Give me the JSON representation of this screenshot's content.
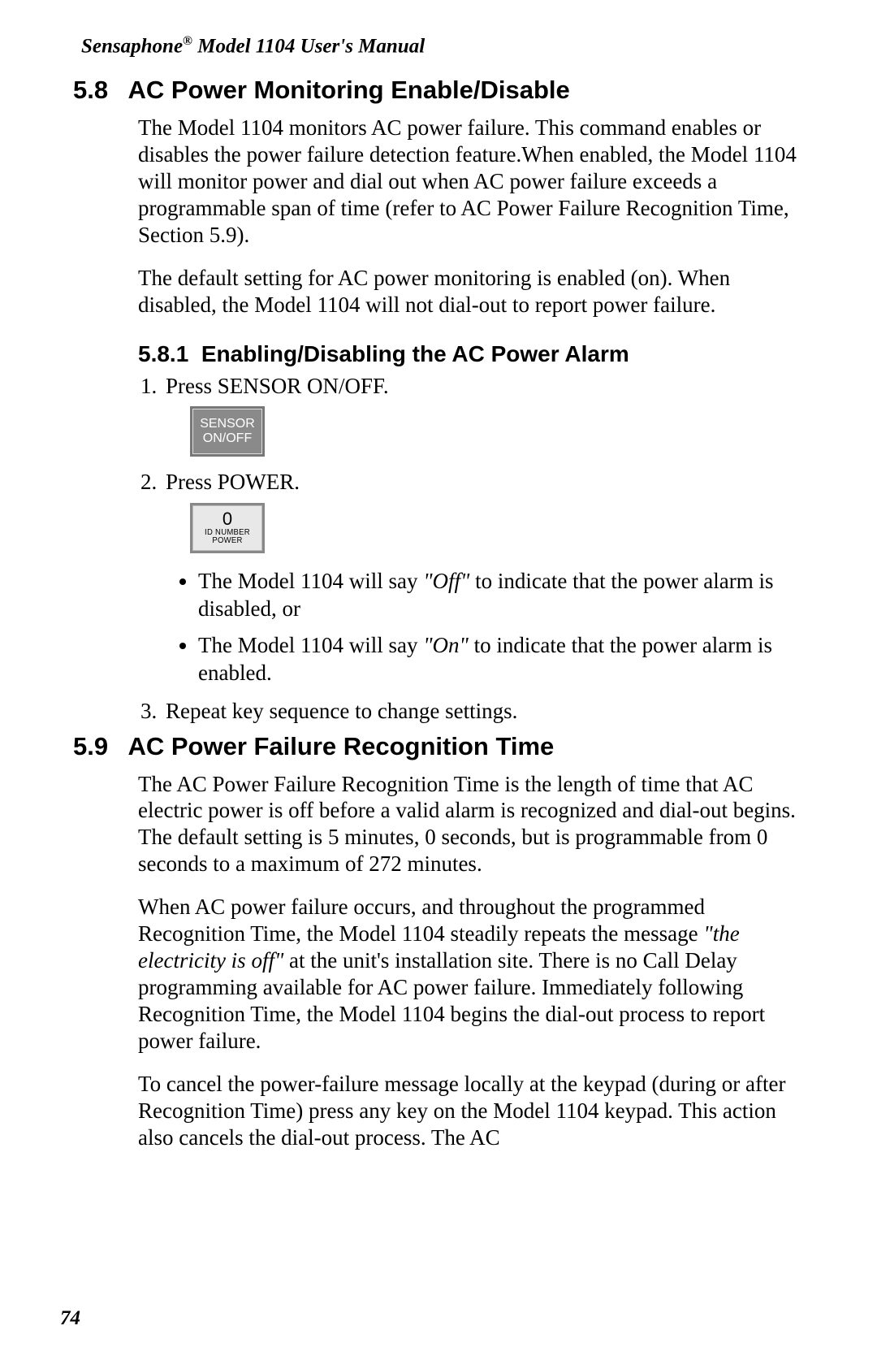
{
  "header": {
    "brand": "Sensaphone",
    "reg": "®",
    "rest": " Model 1104 User's Manual"
  },
  "sec58": {
    "num": "5.8",
    "title": "AC Power Monitoring Enable/Disable",
    "p1": "The Model 1104 monitors AC power failure. This command enables or disables the power failure detection feature.When enabled, the Model 1104 will monitor power and dial out when AC power failure exceeds a programmable span of  time (refer to AC Power Failure Recognition Time, Section 5.9).",
    "p2": "The default setting for AC power monitoring is enabled (on). When disabled, the Model 1104 will not dial-out to report power failure."
  },
  "sec581": {
    "num": "5.8.1",
    "title": "Enabling/Disabling the AC Power Alarm",
    "step1": "Press SENSOR ON/OFF.",
    "step2": "Press POWER.",
    "bullet1_a": "The Model 1104 will say ",
    "bullet1_q": "\"Off\"",
    "bullet1_b": " to indicate that the power alarm is disabled, or",
    "bullet2_a": "The Model 1104 will say ",
    "bullet2_q": "\"On\"",
    "bullet2_b": " to indicate that the power alarm is enabled.",
    "step3": "Repeat key sequence to change settings."
  },
  "key_sensor": {
    "line1": "SENSOR",
    "line2": "ON/OFF"
  },
  "key_power": {
    "big": "0",
    "line1": "ID NUMBER",
    "line2": "POWER"
  },
  "sec59": {
    "num": "5.9",
    "title": "AC Power Failure Recognition Time",
    "p1": "The AC Power Failure Recognition Time is the length of time that AC electric power is off before a valid alarm is recognized and dial-out begins. The default setting is 5 minutes, 0 seconds, but is programmable from 0 seconds to a maximum of 272 minutes.",
    "p2_a": "When AC power failure occurs, and throughout the programmed Recognition Time, the Model 1104 steadily repeats the message ",
    "p2_q": "\"the electricity is off\"",
    "p2_b": " at the unit's installation site. There is no Call Delay programming available for AC power failure. Immediately following Recognition Time, the Model 1104 begins the dial-out process to report power failure.",
    "p3": "To cancel the power-failure message locally at the keypad (during or after Recognition Time) press any key on the Model 1104 keypad. This action also cancels the dial-out process. The AC"
  },
  "page_number": "74"
}
